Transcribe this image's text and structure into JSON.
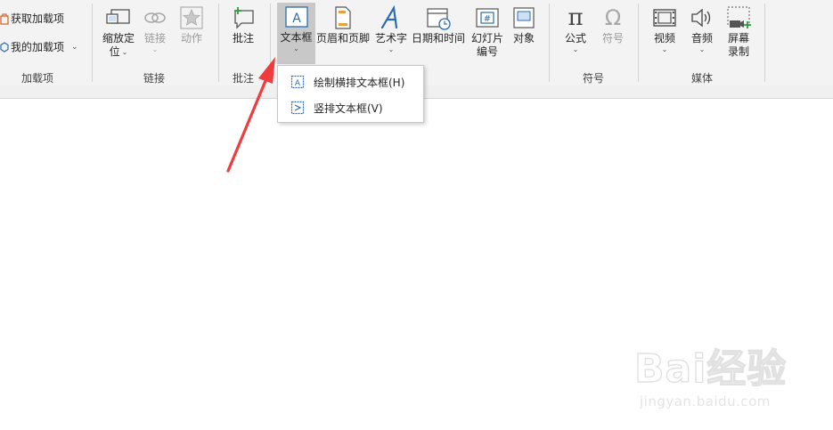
{
  "ribbon": {
    "addins": {
      "get_addins": "获取加载项",
      "my_addins": "我的加载项",
      "group_label": "加载项"
    },
    "links": {
      "zoom": "缩放定",
      "zoom2": "位",
      "link": "链接",
      "action": "动作",
      "group_label": "链接"
    },
    "comments": {
      "comment": "批注",
      "group_label": "批注"
    },
    "text": {
      "textbox": "文本框",
      "header_footer": "页眉和页脚",
      "wordart": "艺术字",
      "datetime": "日期和时间",
      "slide_number": "幻灯片",
      "slide_number2": "编号",
      "object": "对象"
    },
    "symbols": {
      "equation": "公式",
      "symbol": "符号",
      "group_label": "符号"
    },
    "media": {
      "video": "视频",
      "audio": "音频",
      "screen_record": "屏幕",
      "screen_record2": "录制",
      "group_label": "媒体"
    }
  },
  "dropdown": {
    "items": [
      {
        "label": "绘制横排文本框(H)"
      },
      {
        "label": "竖排文本框(V)"
      }
    ]
  },
  "watermark": {
    "brand": "Bai经验",
    "url": "jingyan.baidu.com"
  },
  "colors": {
    "ribbon_bg": "#f3f3f3",
    "accent_blue": "#2b6cb0",
    "arrow_red": "#f03c3c",
    "addin_orange": "#d9642a"
  }
}
